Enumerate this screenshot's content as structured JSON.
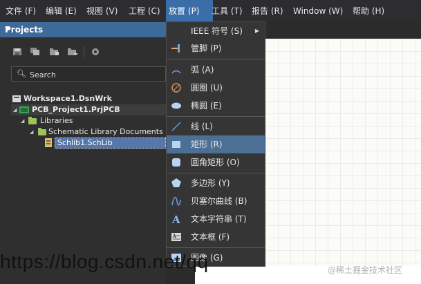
{
  "menubar": {
    "items": [
      {
        "label": "文件 (F)"
      },
      {
        "label": "编辑 (E)"
      },
      {
        "label": "视图 (V)"
      },
      {
        "label": "工程 (C)"
      },
      {
        "label": "放置 (P)"
      },
      {
        "label": "工具 (T)"
      },
      {
        "label": "报告 (R)"
      },
      {
        "label": "Window (W)"
      },
      {
        "label": "帮助 (H)"
      }
    ]
  },
  "projects_panel": {
    "title": "Projects",
    "search_placeholder": "Search",
    "tree": {
      "workspace": "Workspace1.DsnWrk",
      "project": "PCB_Project1.PrjPCB",
      "libraries": "Libraries",
      "schlib_folder": "Schematic Library Documents",
      "schlib_file": "Schlib1.SchLib"
    }
  },
  "place_menu": {
    "items": [
      {
        "label": "IEEE 符号 (S)",
        "icon": "none",
        "submenu": true
      },
      {
        "label": "管脚 (P)",
        "icon": "pin-icon"
      },
      {
        "label": "弧 (A)",
        "icon": "arc-icon"
      },
      {
        "label": "圆圈 (U)",
        "icon": "circle-icon"
      },
      {
        "label": "椭圆 (E)",
        "icon": "ellipse-icon"
      },
      {
        "label": "线 (L)",
        "icon": "line-icon"
      },
      {
        "label": "矩形 (R)",
        "icon": "rectangle-icon",
        "highlighted": true
      },
      {
        "label": "圆角矩形 (O)",
        "icon": "round-rectangle-icon"
      },
      {
        "label": "多边形 (Y)",
        "icon": "polygon-icon"
      },
      {
        "label": "贝塞尔曲线 (B)",
        "icon": "bezier-icon"
      },
      {
        "label": "文本字符串 (T)",
        "icon": "text-string-icon"
      },
      {
        "label": "文本框 (F)",
        "icon": "text-frame-icon"
      },
      {
        "label": "图像 (G)",
        "icon": "image-icon"
      }
    ]
  },
  "watermark": {
    "url_text": "https://blog.csdn.net/qq",
    "site_text": "@稀土掘金技术社区"
  },
  "colors": {
    "menu_active": "#3b6ea8",
    "panel_title": "#3d6a98",
    "menu_highlight": "#4c6f95"
  }
}
